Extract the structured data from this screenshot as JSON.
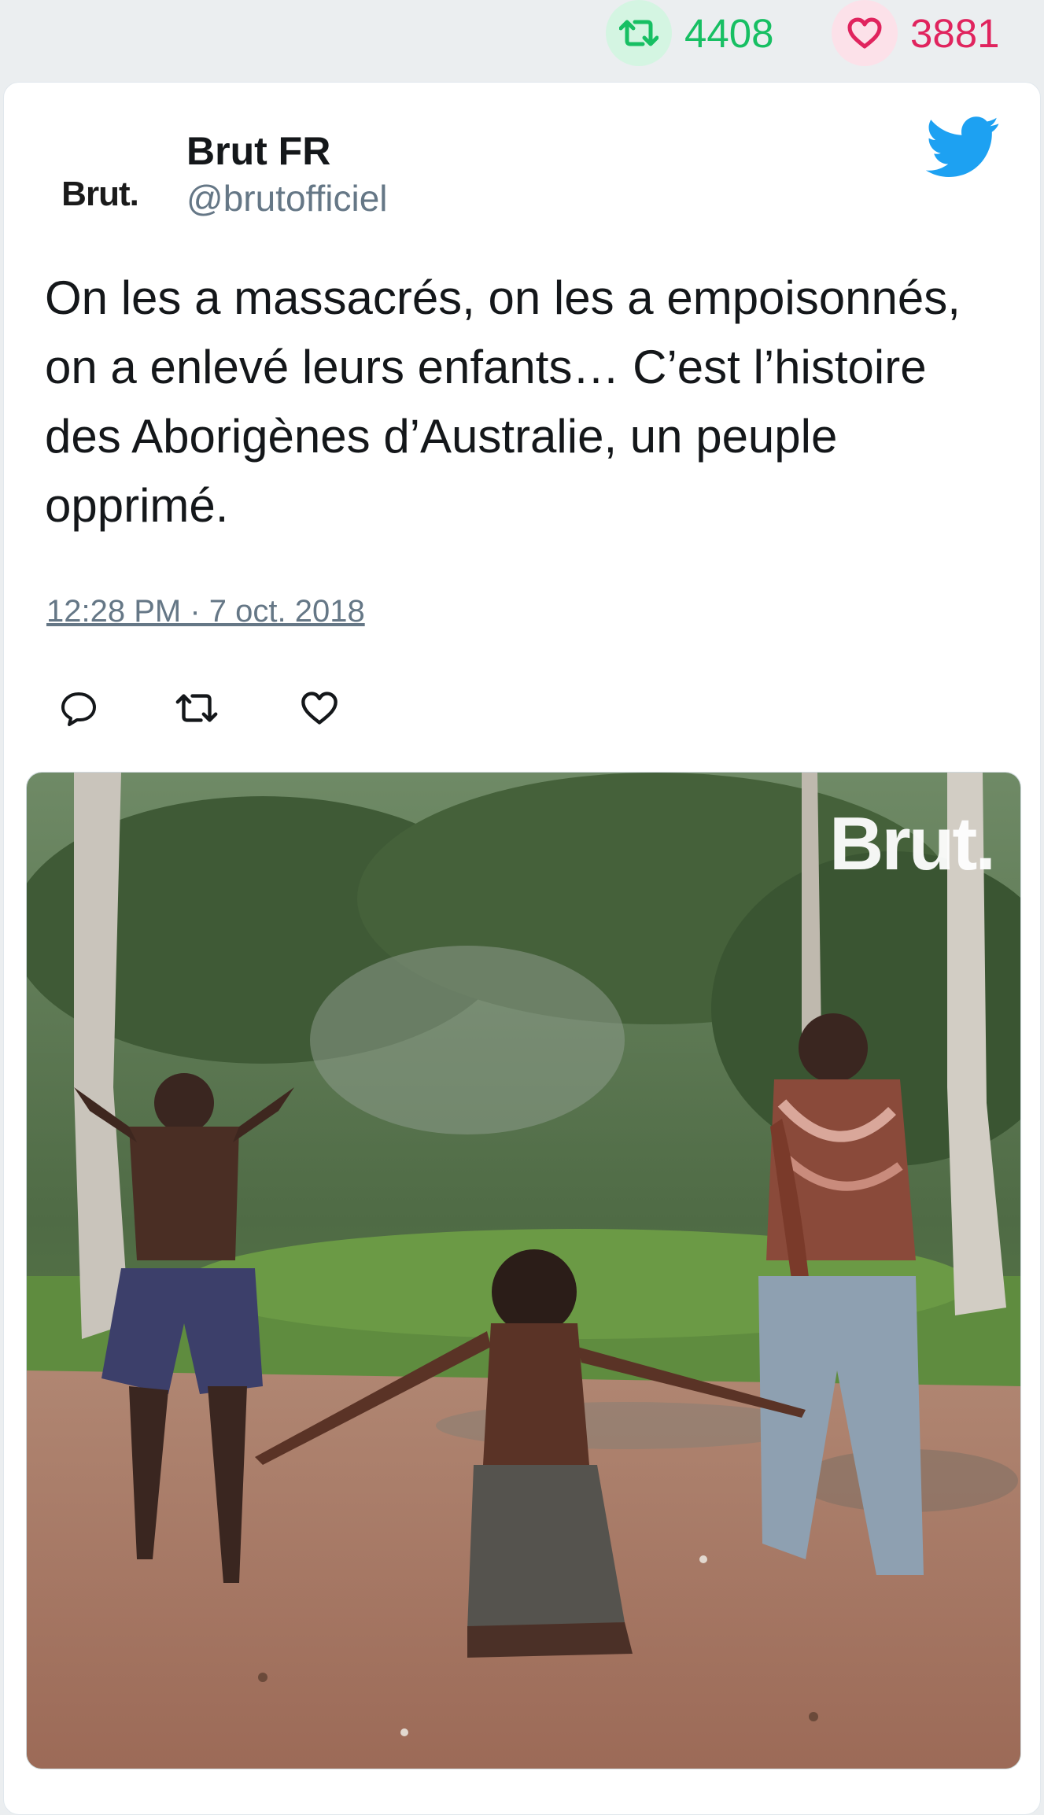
{
  "stats": {
    "retweets": "4408",
    "likes": "3881",
    "retweet_icon": "retweet-icon",
    "like_icon": "heart-icon"
  },
  "tweet": {
    "avatar_text": "Brut.",
    "display_name": "Brut FR",
    "handle": "@brutofficiel",
    "text": "On les a massacrés, on les a empoisonnés, on a enlevé leurs enfants… C’est l’histoire des Aborigènes d’Australie, un peuple opprimé.",
    "timestamp": "12:28 PM · 7 oct. 2018",
    "media_watermark": "Brut."
  },
  "colors": {
    "retweet": "#17bf63",
    "like": "#e0245e",
    "twitter_blue": "#1da1f2",
    "secondary_text": "#657786"
  }
}
